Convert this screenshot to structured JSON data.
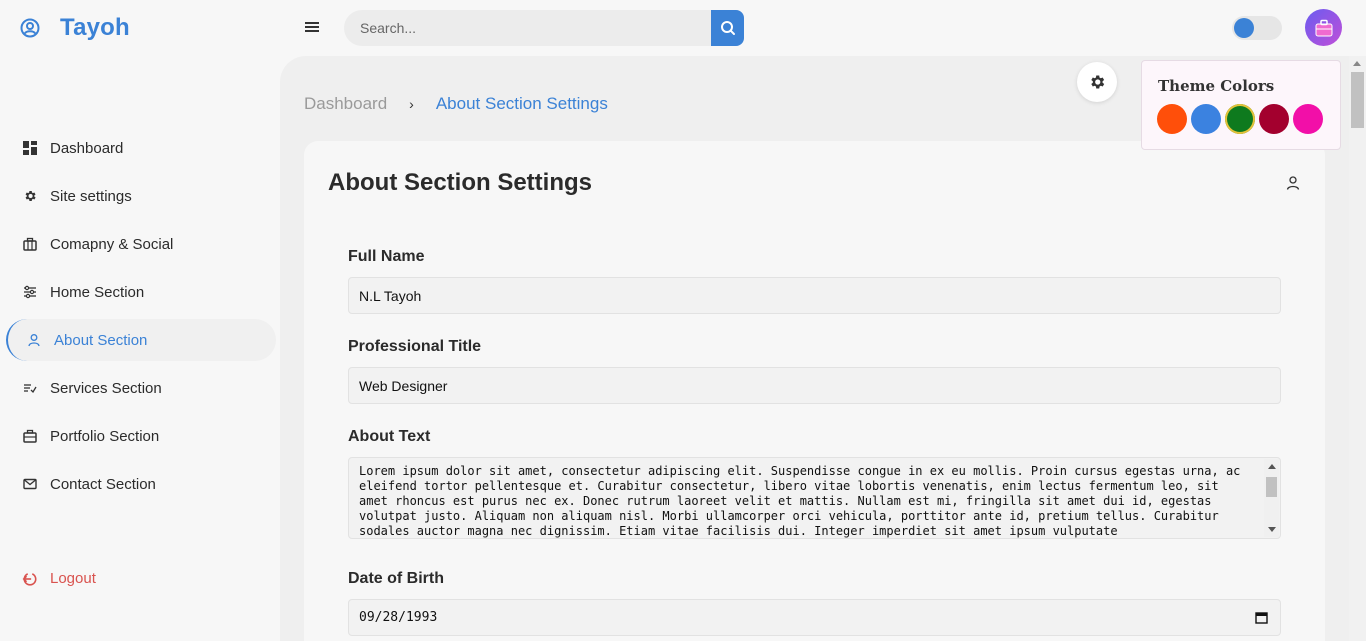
{
  "brand": {
    "name": "Tayoh",
    "icon": "user-circle-icon"
  },
  "search": {
    "placeholder": "Search...",
    "icon": "search-icon"
  },
  "theme_toggle": {
    "state": "on"
  },
  "sidebar": {
    "items": [
      {
        "label": "Dashboard",
        "icon": "grid-icon"
      },
      {
        "label": "Site settings",
        "icon": "gear-icon"
      },
      {
        "label": "Comapny & Social",
        "icon": "briefcase-icon"
      },
      {
        "label": "Home Section",
        "icon": "sliders-icon"
      },
      {
        "label": "About Section",
        "icon": "user-icon",
        "active": true
      },
      {
        "label": "Services Section",
        "icon": "list-check-icon"
      },
      {
        "label": "Portfolio Section",
        "icon": "toolbox-icon"
      },
      {
        "label": "Contact Section",
        "icon": "mail-icon"
      }
    ],
    "logout": "Logout"
  },
  "breadcrumb": {
    "home": "Dashboard",
    "separator": "›",
    "current": "About Section Settings"
  },
  "card": {
    "title": "About Section Settings",
    "fields": {
      "full_name": {
        "label": "Full Name",
        "value": "N.L Tayoh"
      },
      "professional_title": {
        "label": "Professional Title",
        "value": "Web Designer"
      },
      "about_text": {
        "label": "About Text",
        "value": "Lorem ipsum dolor sit amet, consectetur adipiscing elit. Suspendisse congue in ex eu mollis. Proin cursus egestas urna, ac eleifend tortor pellentesque et. Curabitur consectetur, libero vitae lobortis venenatis, enim lectus fermentum leo, sit amet rhoncus est purus nec ex. Donec rutrum laoreet velit et mattis. Nullam est mi, fringilla sit amet dui id, egestas volutpat justo. Aliquam non aliquam nisl. Morbi ullamcorper orci vehicula, porttitor ante id, pretium tellus. Curabitur sodales auctor magna nec dignissim. Etiam vitae facilisis dui. Integer imperdiet sit amet ipsum vulputate"
      },
      "date_of_birth": {
        "label": "Date of Birth",
        "value": "09/28/1993"
      }
    }
  },
  "theme_panel": {
    "title": "Theme Colors",
    "colors": [
      "#ff4f0a",
      "#3b82e0",
      "#0e7a1e",
      "#a3002e",
      "#f20fa8"
    ],
    "selected_index": 2
  },
  "colors": {
    "accent": "#3b82d6",
    "logout": "#d9534f"
  }
}
